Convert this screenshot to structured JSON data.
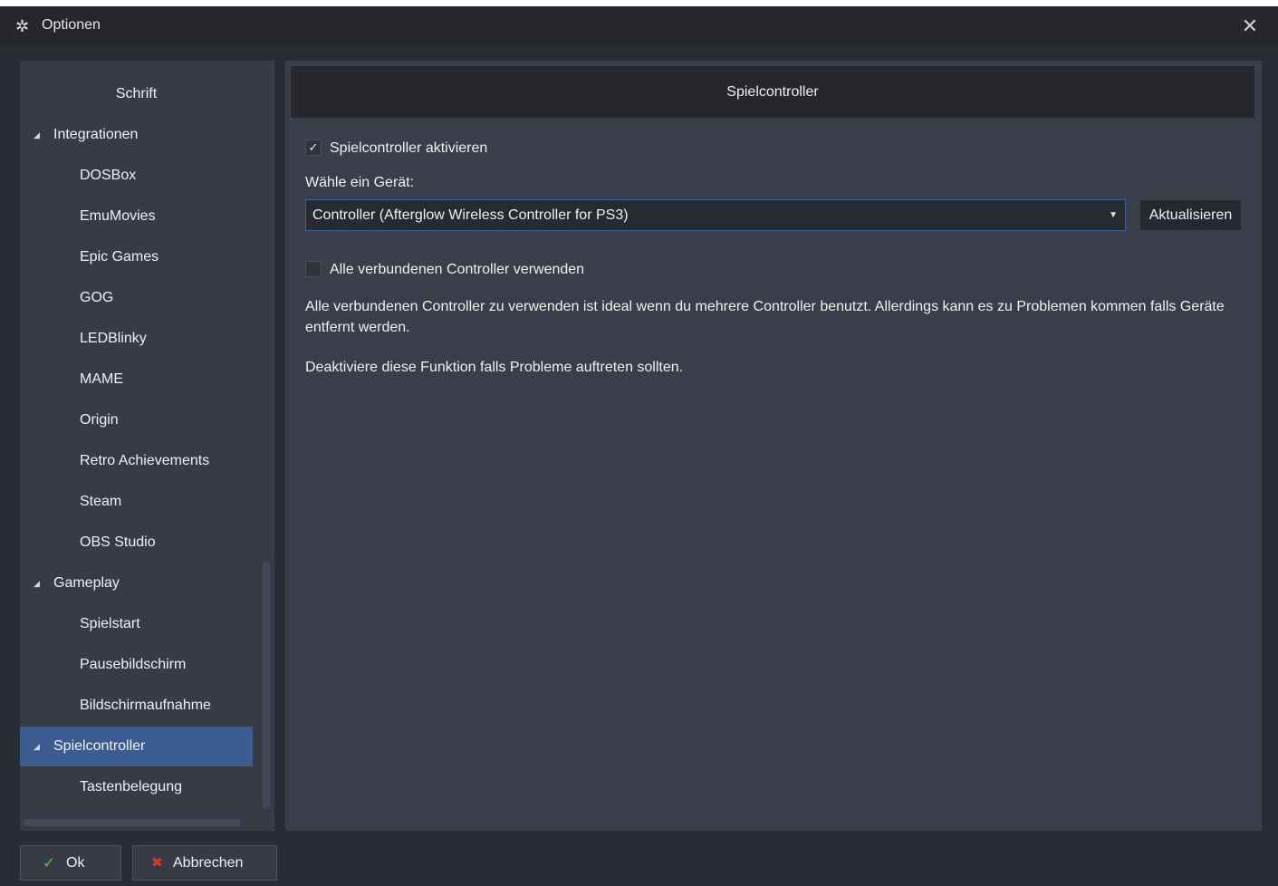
{
  "window": {
    "title": "Optionen",
    "title_icon": "gear-icon",
    "close_symbol": "✕"
  },
  "sidebar": {
    "items": [
      {
        "label": "Schrift",
        "level": 0
      },
      {
        "label": "Integrationen",
        "level": 1,
        "expanded": true
      },
      {
        "label": "DOSBox",
        "level": 2
      },
      {
        "label": "EmuMovies",
        "level": 2
      },
      {
        "label": "Epic Games",
        "level": 2
      },
      {
        "label": "GOG",
        "level": 2
      },
      {
        "label": "LEDBlinky",
        "level": 2
      },
      {
        "label": "MAME",
        "level": 2
      },
      {
        "label": "Origin",
        "level": 2
      },
      {
        "label": "Retro Achievements",
        "level": 2
      },
      {
        "label": "Steam",
        "level": 2
      },
      {
        "label": "OBS Studio",
        "level": 2
      },
      {
        "label": "Gameplay",
        "level": 1,
        "expanded": true
      },
      {
        "label": "Spielstart",
        "level": 2
      },
      {
        "label": "Pausebildschirm",
        "level": 2
      },
      {
        "label": "Bildschirmaufnahme",
        "level": 2
      },
      {
        "label": "Spielcontroller",
        "level": 1,
        "expanded": true,
        "selected": true
      },
      {
        "label": "Tastenbelegung",
        "level": 2
      }
    ],
    "expand_arrow": "◢",
    "selected_color": "#3c5c8f"
  },
  "content": {
    "header": "Spielcontroller",
    "enable_checkbox": {
      "label": "Spielcontroller aktivieren",
      "checked": true
    },
    "device_label": "Wähle ein Gerät:",
    "device_select": {
      "value": "Controller (Afterglow Wireless Controller for PS3)"
    },
    "refresh_button": "Aktualisieren",
    "all_controllers_checkbox": {
      "label": "Alle verbundenen Controller verwenden",
      "checked": false
    },
    "info_text": "Alle verbundenen Controller zu verwenden ist ideal wenn du mehrere Controller benutzt. Allerdings kann es zu Problemen kommen falls Geräte entfernt werden.",
    "hint_text": "Deaktiviere diese Funktion falls Probleme auftreten sollten."
  },
  "footer": {
    "ok_label": "Ok",
    "ok_icon": "checkmark-icon",
    "cancel_label": "Abbrechen",
    "cancel_icon": "cross-icon"
  }
}
